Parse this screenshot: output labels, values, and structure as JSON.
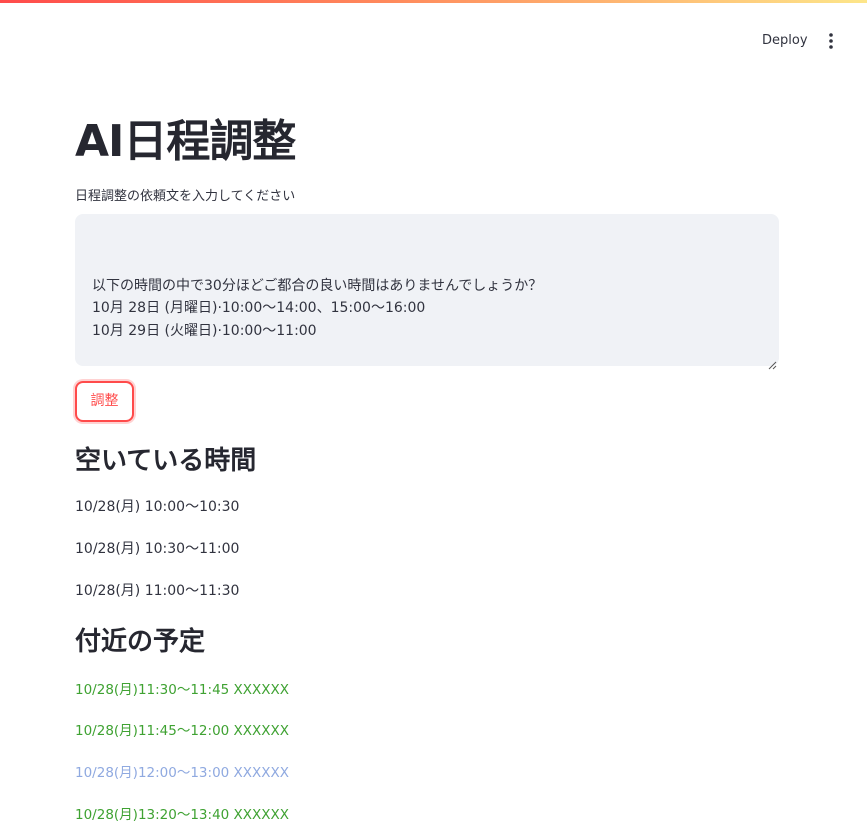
{
  "header": {
    "deploy_label": "Deploy",
    "menu_icon": "vertical-ellipsis-icon"
  },
  "main": {
    "title": "AI日程調整",
    "request_label": "日程調整の依頼文を入力してください",
    "request_text": "\n以下の時間の中で30分ほどご都合の良い時間はありませんでしょうか？\n10月 28日 (月曜日)·10:00〜14:00、15:00〜16:00\n10月 29日 (火曜日)·10:00〜11:00",
    "adjust_button_label": "調整"
  },
  "free_times": {
    "heading": "空いている時間",
    "slots": [
      "10/28(月) 10:00〜10:30",
      "10/28(月) 10:30〜11:00",
      "10/28(月) 11:00〜11:30"
    ]
  },
  "nearby_events": {
    "heading": "付近の予定",
    "events": [
      {
        "text": "10/28(月)11:30〜11:45 XXXXXX",
        "color": "#3fa232"
      },
      {
        "text": "10/28(月)11:45〜12:00 XXXXXX",
        "color": "#3fa232"
      },
      {
        "text": "10/28(月)12:00〜13:00 XXXXXX",
        "color": "#8fa9e0"
      },
      {
        "text": "10/28(月)13:20〜13:40 XXXXXX",
        "color": "#3fa232"
      }
    ]
  },
  "colors": {
    "accent": "#ff4b4b",
    "input_background": "#f0f2f6",
    "text": "#31333f"
  }
}
